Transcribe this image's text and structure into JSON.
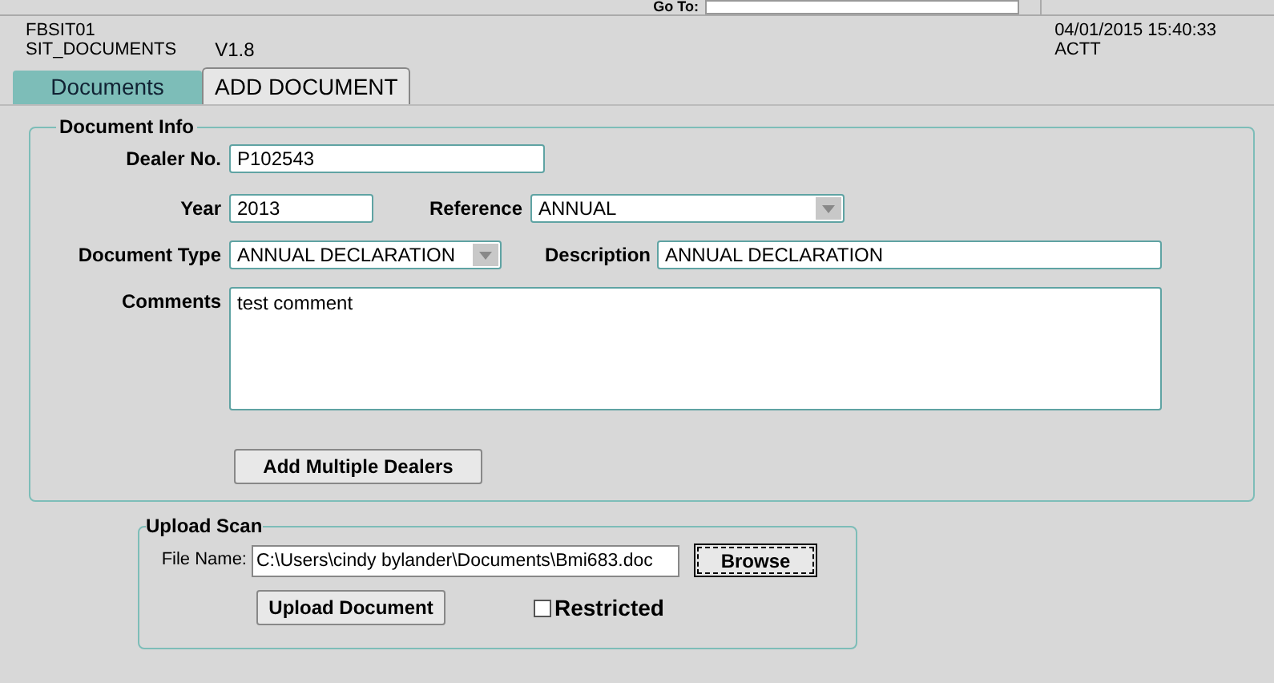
{
  "goto": {
    "label": "Go To:"
  },
  "header": {
    "form_id": "FBSIT01",
    "form_name": "SIT_DOCUMENTS",
    "version": "V1.8",
    "datetime": "04/01/2015 15:40:33",
    "user": "ACTT"
  },
  "tabs": [
    {
      "label": "Documents",
      "selected": false
    },
    {
      "label": "ADD DOCUMENT",
      "selected": true
    }
  ],
  "document_info": {
    "title": "Document Info",
    "dealer_no": {
      "label": "Dealer No.",
      "value": "P102543"
    },
    "year": {
      "label": "Year",
      "value": "2013"
    },
    "reference": {
      "label": "Reference",
      "value": "ANNUAL"
    },
    "document_type": {
      "label": "Document Type",
      "value": "ANNUAL DECLARATION"
    },
    "description": {
      "label": "Description",
      "value": "ANNUAL DECLARATION"
    },
    "comments": {
      "label": "Comments",
      "value": "test comment"
    },
    "button": "Add Multiple Dealers"
  },
  "upload_scan": {
    "title": "Upload Scan",
    "file_label": "File Name:",
    "file_value": "C:\\Users\\cindy bylander\\Documents\\Bmi683.doc",
    "browse": "Browse",
    "upload": "Upload Document",
    "restricted": {
      "label": "Restricted",
      "checked": false
    }
  }
}
